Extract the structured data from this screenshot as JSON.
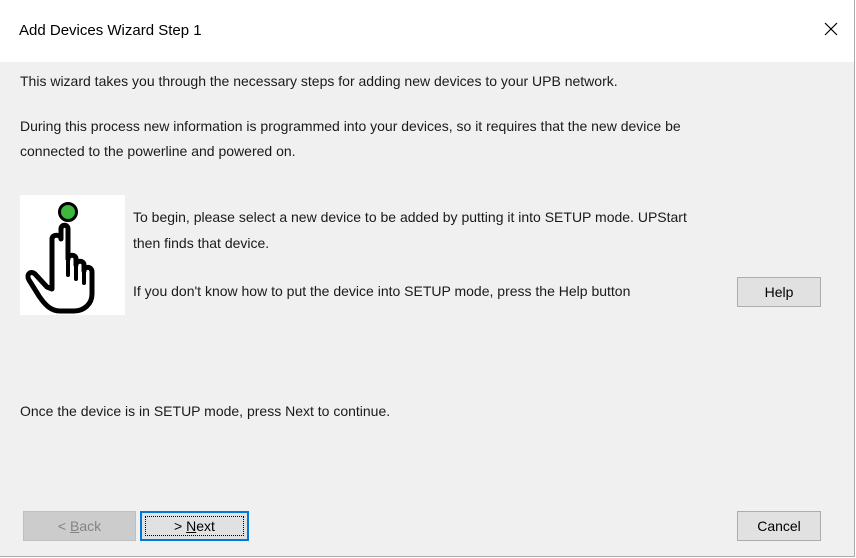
{
  "window": {
    "title": "Add Devices Wizard Step 1",
    "close_icon": "close-icon"
  },
  "content": {
    "intro_line1": "This wizard takes you through the necessary steps for adding new devices to your UPB network.",
    "intro_line2a": "During this process new information is programmed into your devices, so it requires that the new device be",
    "intro_line2b": "connected to the powerline and powered on.",
    "begin_line1": "To begin, please select a new device to be added by putting it into SETUP mode.  UPStart",
    "begin_line2": "then finds that device.",
    "help_hint": "If you don't know how to put the device into SETUP mode, press the Help button",
    "continue_text": "Once the device is in SETUP mode, press Next to continue.",
    "hand_icon": "hand-pointer-button-icon",
    "led_color": "#3db83d"
  },
  "buttons": {
    "help": "Help",
    "back_prefix": "< ",
    "back_mnemonic": "B",
    "back_rest": "ack",
    "next_prefix": "> ",
    "next_mnemonic": "N",
    "next_rest": "ext",
    "cancel": "Cancel",
    "back_enabled": false
  }
}
